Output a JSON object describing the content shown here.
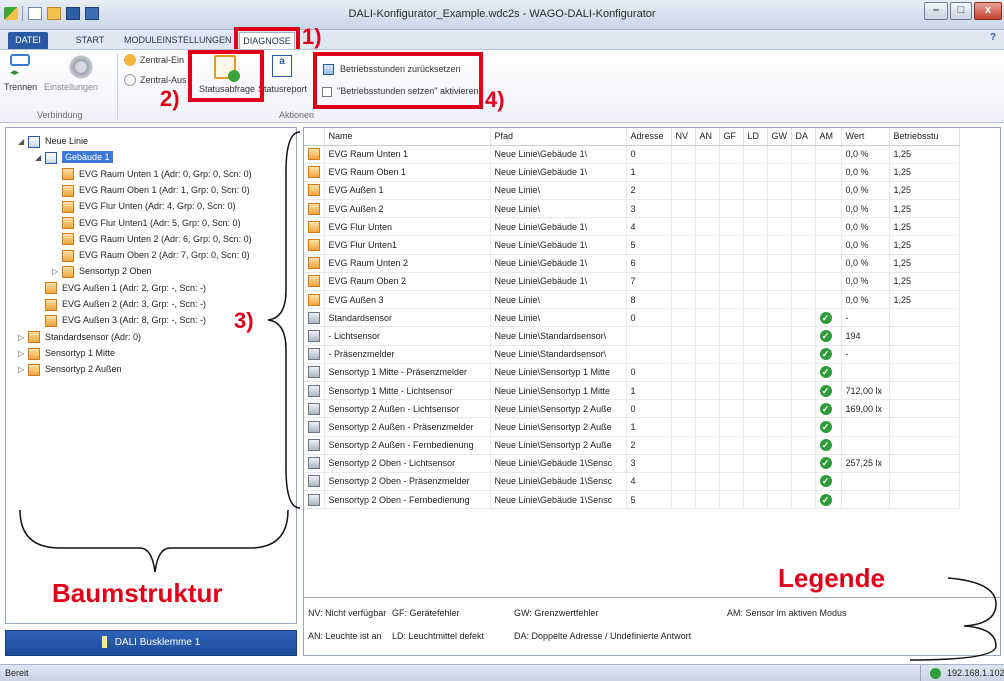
{
  "window": {
    "title": "DALI-Konfigurator_Example.wdc2s - WAGO-DALI-Konfigurator",
    "min": "–",
    "max": "□",
    "close": "x",
    "help": "?"
  },
  "tabs": [
    "DATEI",
    "START",
    "MODULEINSTELLUNGEN",
    "DIAGNOSE"
  ],
  "ribbon": {
    "trennen": "Trennen",
    "einstellungen": "Einstellungen",
    "group_verbindung": "Verbindung",
    "zentral_ein": "Zentral-Ein",
    "zentral_aus": "Zentral-Aus",
    "statusabfrage": "Statusabfrage",
    "statusreport": "Statusreport",
    "group_aktionen": "Aktionen",
    "reset_hours": "Betriebsstunden zurücksetzen",
    "activate_hours": "\"Betriebsstunden setzen\" aktivieren"
  },
  "annotations": {
    "a1": "1)",
    "a2": "2)",
    "a3": "3)",
    "a4": "4)",
    "baum": "Baumstruktur",
    "legende": "Legende"
  },
  "tree": [
    {
      "label": "Neue Linie",
      "level": 0,
      "expander": "◢",
      "icon": "line"
    },
    {
      "label": "Gebäude 1",
      "level": 1,
      "expander": "◢",
      "icon": "building",
      "selected": true
    },
    {
      "label": "EVG Raum Unten 1 (Adr: 0, Grp: 0, Scn: 0)",
      "level": 2,
      "icon": "ballast"
    },
    {
      "label": "EVG Raum Oben 1 (Adr: 1, Grp: 0, Scn: 0)",
      "level": 2,
      "icon": "ballast"
    },
    {
      "label": "EVG Flur Unten (Adr: 4, Grp: 0, Scn: 0)",
      "level": 2,
      "icon": "ballast"
    },
    {
      "label": "EVG Flur Unten1 (Adr: 5, Grp: 0, Scn: 0)",
      "level": 2,
      "icon": "ballast"
    },
    {
      "label": "EVG Raum Unten 2 (Adr: 6, Grp: 0, Scn: 0)",
      "level": 2,
      "icon": "ballast"
    },
    {
      "label": "EVG Raum Oben 2 (Adr: 7, Grp: 0, Scn: 0)",
      "level": 2,
      "icon": "ballast"
    },
    {
      "label": "Sensortyp 2 Oben",
      "level": 2,
      "expander": "▷",
      "icon": "sensor"
    },
    {
      "label": "EVG Außen 1 (Adr: 2, Grp: -, Scn: -)",
      "level": 1,
      "icon": "ballast"
    },
    {
      "label": "EVG Außen 2 (Adr: 3, Grp: -, Scn: -)",
      "level": 1,
      "icon": "ballast"
    },
    {
      "label": "EVG Außen 3 (Adr: 8, Grp: -, Scn: -)",
      "level": 1,
      "icon": "ballast"
    },
    {
      "label": "Standardsensor (Adr: 0)",
      "level": 0,
      "expander": "▷",
      "icon": "sensor"
    },
    {
      "label": "Sensortyp 1 Mitte",
      "level": 0,
      "expander": "▷",
      "icon": "sensor"
    },
    {
      "label": "Sensortyp 2 Außen",
      "level": 0,
      "expander": "▷",
      "icon": "sensor"
    }
  ],
  "table": {
    "columns": [
      "Name",
      "Pfad",
      "Adresse",
      "NV",
      "AN",
      "GF",
      "LD",
      "GW",
      "DA",
      "AM",
      "Wert",
      "Betriebsstu"
    ],
    "rows": [
      {
        "icon": "ballast",
        "name": "EVG Raum Unten 1",
        "pfad": "Neue Linie\\Gebäude 1\\",
        "adr": "0",
        "am": false,
        "wert": "0,0 %",
        "bs": "1,25"
      },
      {
        "icon": "ballast",
        "name": "EVG Raum Oben 1",
        "pfad": "Neue Linie\\Gebäude 1\\",
        "adr": "1",
        "am": false,
        "wert": "0,0 %",
        "bs": "1,25"
      },
      {
        "icon": "ballast",
        "name": "EVG Außen 1",
        "pfad": "Neue Linie\\",
        "adr": "2",
        "am": false,
        "wert": "0,0 %",
        "bs": "1,25"
      },
      {
        "icon": "ballast",
        "name": "EVG Außen 2",
        "pfad": "Neue Linie\\",
        "adr": "3",
        "am": false,
        "wert": "0,0 %",
        "bs": "1,25"
      },
      {
        "icon": "ballast",
        "name": "EVG Flur Unten",
        "pfad": "Neue Linie\\Gebäude 1\\",
        "adr": "4",
        "am": false,
        "wert": "0,0 %",
        "bs": "1,25"
      },
      {
        "icon": "ballast",
        "name": "EVG Flur Unten1",
        "pfad": "Neue Linie\\Gebäude 1\\",
        "adr": "5",
        "am": false,
        "wert": "0,0 %",
        "bs": "1,25"
      },
      {
        "icon": "ballast",
        "name": "EVG Raum Unten 2",
        "pfad": "Neue Linie\\Gebäude 1\\",
        "adr": "6",
        "am": false,
        "wert": "0,0 %",
        "bs": "1,25"
      },
      {
        "icon": "ballast",
        "name": "EVG Raum Oben 2",
        "pfad": "Neue Linie\\Gebäude 1\\",
        "adr": "7",
        "am": false,
        "wert": "0,0 %",
        "bs": "1,25"
      },
      {
        "icon": "ballast",
        "name": "EVG Außen 3",
        "pfad": "Neue Linie\\",
        "adr": "8",
        "am": false,
        "wert": "0,0 %",
        "bs": "1,25"
      },
      {
        "icon": "sensor",
        "name": "Standardsensor",
        "pfad": "Neue Linie\\",
        "adr": "0",
        "am": true,
        "wert": "-",
        "bs": ""
      },
      {
        "icon": "lightsensor",
        "name": "- Lichtsensor",
        "pfad": "Neue Linie\\Standardsensor\\",
        "adr": "",
        "am": true,
        "wert": "194",
        "bs": ""
      },
      {
        "icon": "presence",
        "name": "- Präsenzmelder",
        "pfad": "Neue Linie\\Standardsensor\\",
        "adr": "",
        "am": true,
        "wert": "-",
        "bs": ""
      },
      {
        "icon": "presence",
        "name": "Sensortyp 1 Mitte - Präsenzmelder",
        "pfad": "Neue Linie\\Sensortyp 1 Mitte",
        "adr": "0",
        "am": true,
        "wert": "",
        "bs": ""
      },
      {
        "icon": "lightsensor",
        "name": "Sensortyp 1 Mitte - Lichtsensor",
        "pfad": "Neue Linie\\Sensortyp 1 Mitte",
        "adr": "1",
        "am": true,
        "wert": "712,00 lx",
        "bs": ""
      },
      {
        "icon": "lightsensor",
        "name": "Sensortyp 2 Außen - Lichtsensor",
        "pfad": "Neue Linie\\Sensortyp 2 Auße",
        "adr": "0",
        "am": true,
        "wert": "169,00 lx",
        "bs": ""
      },
      {
        "icon": "presence",
        "name": "Sensortyp 2 Außen - Präsenzmelder",
        "pfad": "Neue Linie\\Sensortyp 2 Auße",
        "adr": "1",
        "am": true,
        "wert": "",
        "bs": ""
      },
      {
        "icon": "remote",
        "name": "Sensortyp 2 Außen - Fernbedienung",
        "pfad": "Neue Linie\\Sensortyp 2 Auße",
        "adr": "2",
        "am": true,
        "wert": "",
        "bs": ""
      },
      {
        "icon": "lightsensor",
        "name": "Sensortyp 2 Oben - Lichtsensor",
        "pfad": "Neue Linie\\Gebäude 1\\Sensc",
        "adr": "3",
        "am": true,
        "wert": "257,25 lx",
        "bs": ""
      },
      {
        "icon": "presence",
        "name": "Sensortyp 2 Oben - Präsenzmelder",
        "pfad": "Neue Linie\\Gebäude 1\\Sensc",
        "adr": "4",
        "am": true,
        "wert": "",
        "bs": ""
      },
      {
        "icon": "remote",
        "name": "Sensortyp 2 Oben - Fernbedienung",
        "pfad": "Neue Linie\\Gebäude 1\\Sensc",
        "adr": "5",
        "am": true,
        "wert": "",
        "bs": ""
      }
    ]
  },
  "legend": {
    "nv": "NV: Nicht verfügbar",
    "gf": "GF: Gerätefehler",
    "gw": "GW: Grenzwertfehler",
    "am": "AM: Sensor im aktiven Modus",
    "an": "AN: Leuchte ist an",
    "ld": "LD: Leuchtmittel defekt",
    "da": "DA: Doppelte Adresse / Undefinierte Antwort"
  },
  "bus_button": "DALI Busklemme 1",
  "status": {
    "text": "Bereit",
    "ip": "192.168.1.102"
  },
  "colors": {
    "accent": "#2a5aa6",
    "annotation": "#e1001a",
    "ok": "#2f9b3a"
  }
}
